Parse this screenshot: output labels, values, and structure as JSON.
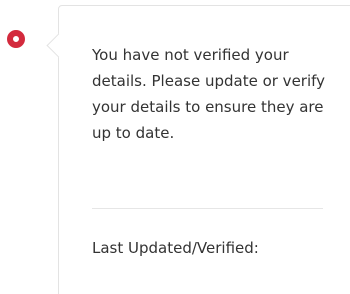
{
  "status": {
    "icon": "ring-icon",
    "color": "#d32a3d"
  },
  "notice": {
    "message": "You have not verified your details. Please update or verify your details to ensure they are up to date.",
    "last_updated_label": "Last Updated/Verified:"
  }
}
